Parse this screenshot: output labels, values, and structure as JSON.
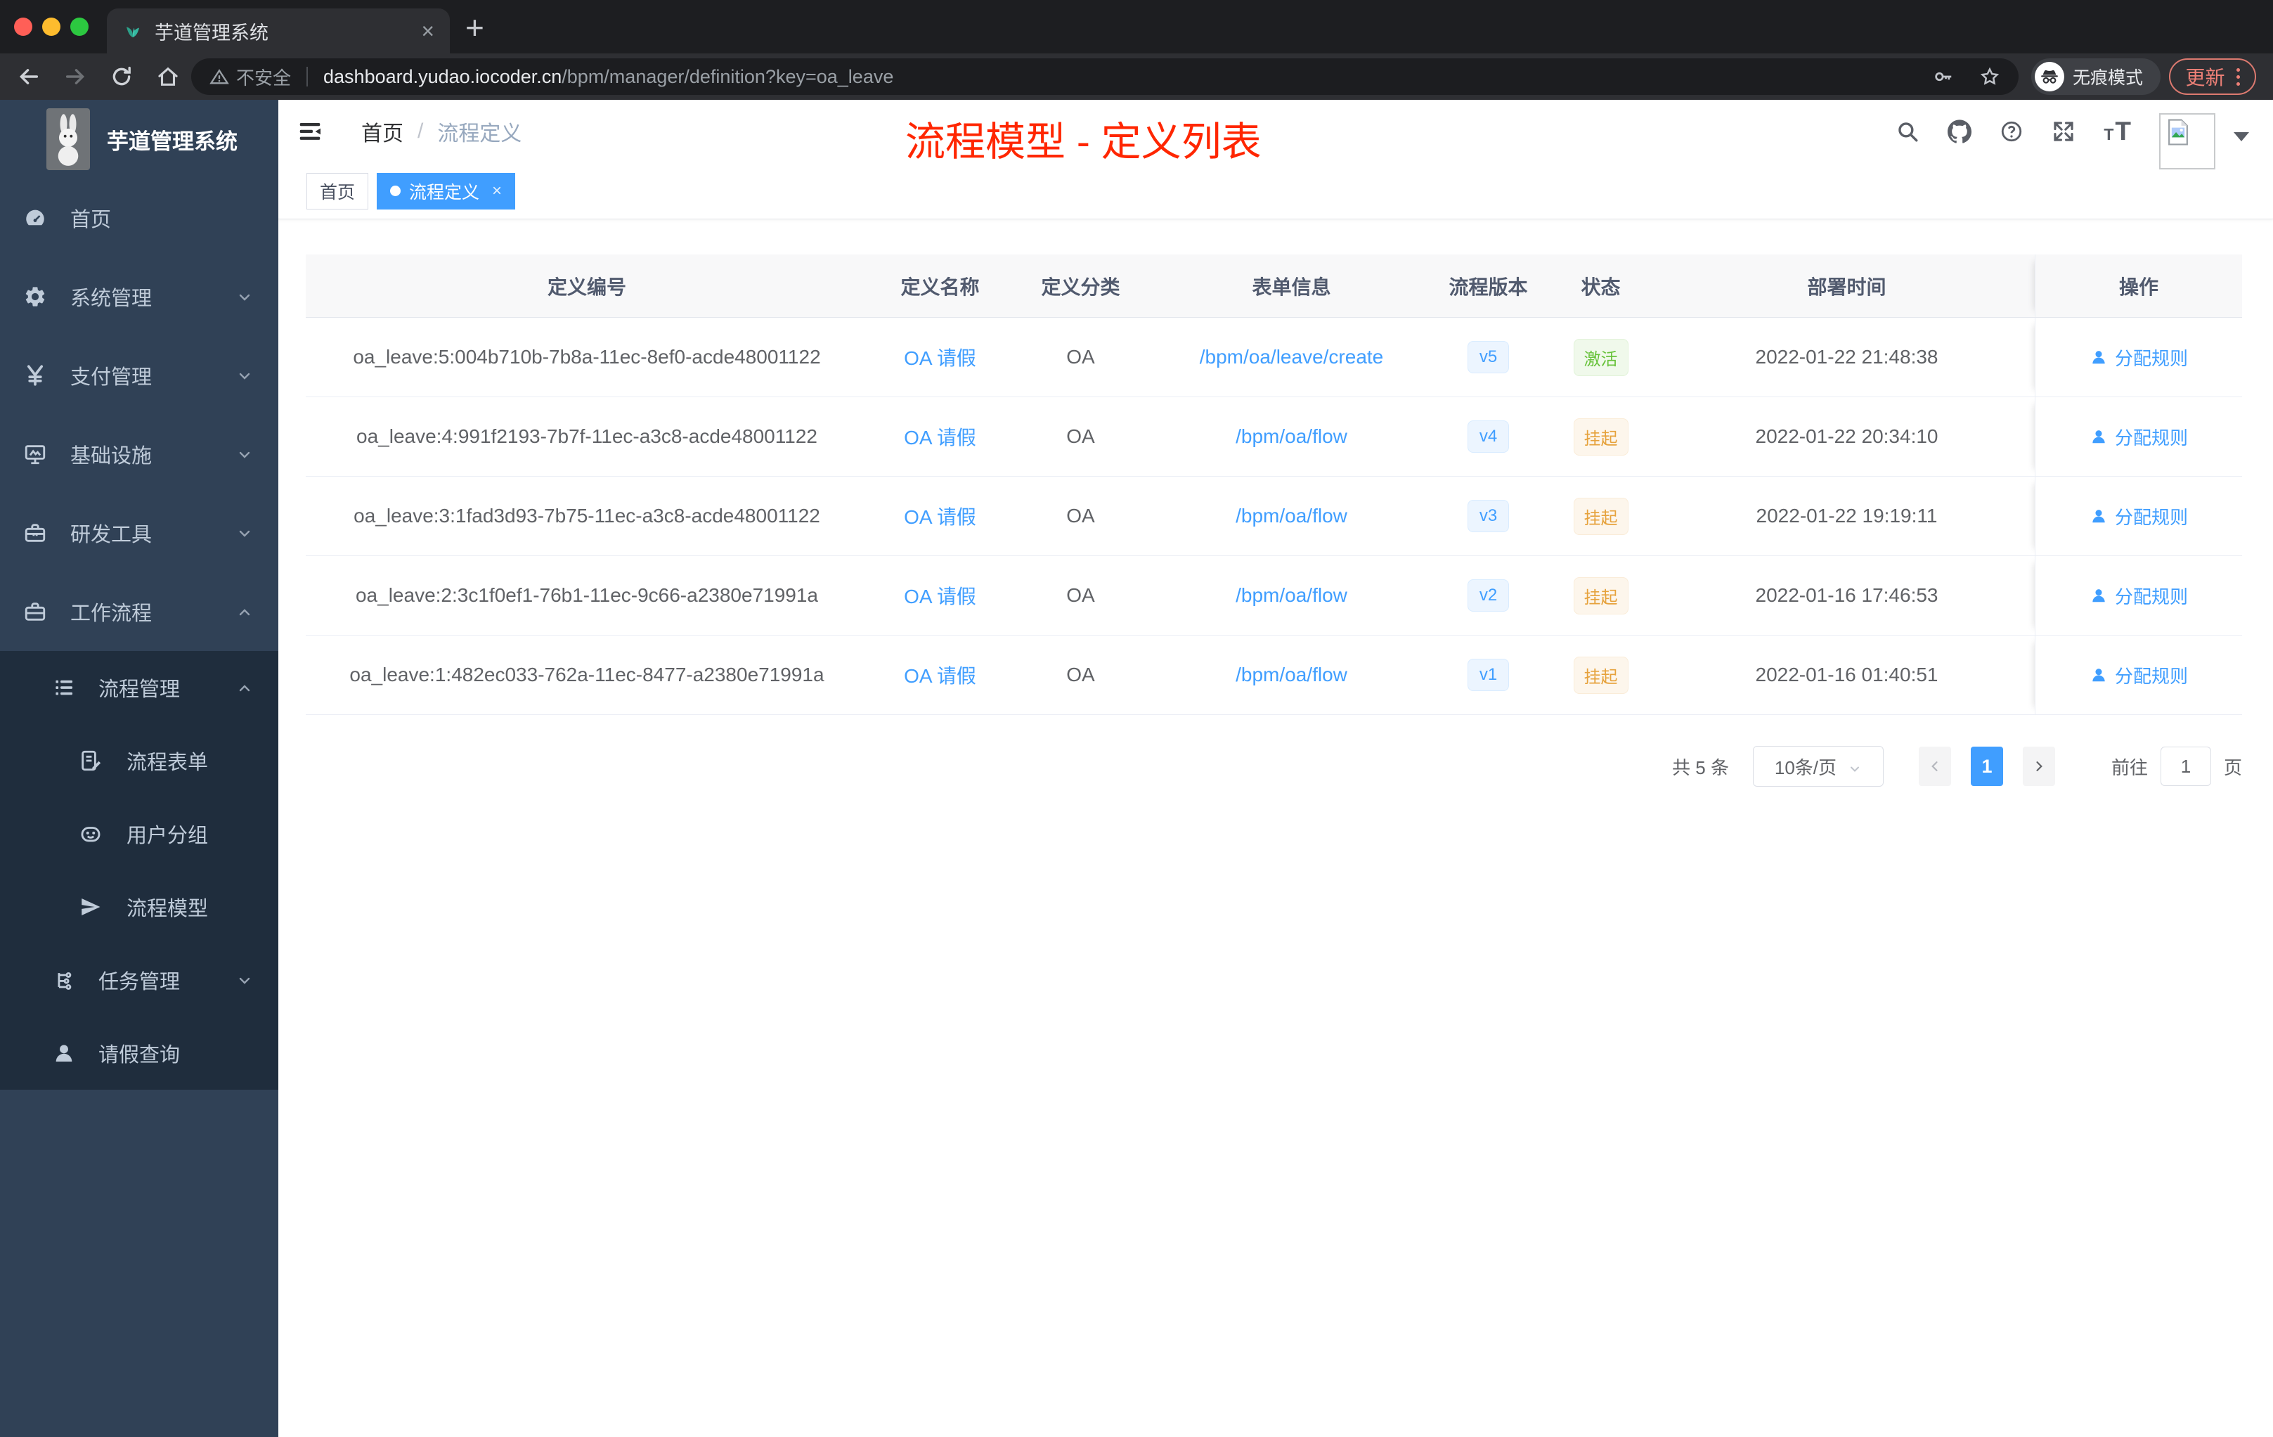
{
  "browser": {
    "tab_title": "芋道管理系统",
    "new_tab_glyph": "+",
    "security_label": "不安全",
    "url_host": "dashboard.yudao.iocoder.cn",
    "url_path": "/bpm/manager/definition?key=oa_leave",
    "incognito_label": "无痕模式",
    "update_label": "更新"
  },
  "sidebar": {
    "app_title": "芋道管理系统",
    "items": [
      {
        "label": "首页",
        "icon": "dashboard-icon",
        "expandable": false
      },
      {
        "label": "系统管理",
        "icon": "gear-icon",
        "expandable": true,
        "state": "collapsed"
      },
      {
        "label": "支付管理",
        "icon": "yen-icon",
        "expandable": true,
        "state": "collapsed"
      },
      {
        "label": "基础设施",
        "icon": "monitor-icon",
        "expandable": true,
        "state": "collapsed"
      },
      {
        "label": "研发工具",
        "icon": "toolbox-icon",
        "expandable": true,
        "state": "collapsed"
      },
      {
        "label": "工作流程",
        "icon": "briefcase-icon",
        "expandable": true,
        "state": "expanded"
      }
    ],
    "submenu": [
      {
        "label": "流程管理",
        "level": 1,
        "icon": "list-icon",
        "state": "expanded"
      },
      {
        "label": "流程表单",
        "level": 2,
        "icon": "form-icon"
      },
      {
        "label": "用户分组",
        "level": 2,
        "icon": "robot-icon"
      },
      {
        "label": "流程模型",
        "level": 2,
        "icon": "send-icon"
      },
      {
        "label": "任务管理",
        "level": 1,
        "icon": "tree-icon",
        "state": "collapsed"
      },
      {
        "label": "请假查询",
        "level": 1,
        "icon": "user-icon"
      }
    ]
  },
  "header": {
    "breadcrumb": [
      "首页",
      "流程定义"
    ],
    "annotation": "流程模型 - 定义列表"
  },
  "tags": [
    {
      "label": "首页",
      "active": false
    },
    {
      "label": "流程定义",
      "active": true
    }
  ],
  "table": {
    "columns": [
      "定义编号",
      "定义名称",
      "定义分类",
      "表单信息",
      "流程版本",
      "状态",
      "部署时间",
      "操作"
    ],
    "rows": [
      {
        "id": "oa_leave:5:004b710b-7b8a-11ec-8ef0-acde48001122",
        "name": "OA 请假",
        "category": "OA",
        "form": "/bpm/oa/leave/create",
        "version": "v5",
        "status": "激活",
        "status_type": "success",
        "deploy_time": "2022-01-22 21:48:38",
        "action": "分配规则"
      },
      {
        "id": "oa_leave:4:991f2193-7b7f-11ec-a3c8-acde48001122",
        "name": "OA 请假",
        "category": "OA",
        "form": "/bpm/oa/flow",
        "version": "v4",
        "status": "挂起",
        "status_type": "warning",
        "deploy_time": "2022-01-22 20:34:10",
        "action": "分配规则"
      },
      {
        "id": "oa_leave:3:1fad3d93-7b75-11ec-a3c8-acde48001122",
        "name": "OA 请假",
        "category": "OA",
        "form": "/bpm/oa/flow",
        "version": "v3",
        "status": "挂起",
        "status_type": "warning",
        "deploy_time": "2022-01-22 19:19:11",
        "action": "分配规则"
      },
      {
        "id": "oa_leave:2:3c1f0ef1-76b1-11ec-9c66-a2380e71991a",
        "name": "OA 请假",
        "category": "OA",
        "form": "/bpm/oa/flow",
        "version": "v2",
        "status": "挂起",
        "status_type": "warning",
        "deploy_time": "2022-01-16 17:46:53",
        "action": "分配规则"
      },
      {
        "id": "oa_leave:1:482ec033-762a-11ec-8477-a2380e71991a",
        "name": "OA 请假",
        "category": "OA",
        "form": "/bpm/oa/flow",
        "version": "v1",
        "status": "挂起",
        "status_type": "warning",
        "deploy_time": "2022-01-16 01:40:51",
        "action": "分配规则"
      }
    ]
  },
  "pagination": {
    "total_label": "共 5 条",
    "page_size": "10条/页",
    "current_page": "1",
    "goto_label": "前往",
    "goto_value": "1",
    "page_unit": "页"
  },
  "colors": {
    "accent": "#409eff",
    "success": "#67c23a",
    "warning": "#e6a23c",
    "annotation": "#ff2600",
    "sidebar_bg": "#304156",
    "submenu_bg": "#1f2d3d"
  }
}
